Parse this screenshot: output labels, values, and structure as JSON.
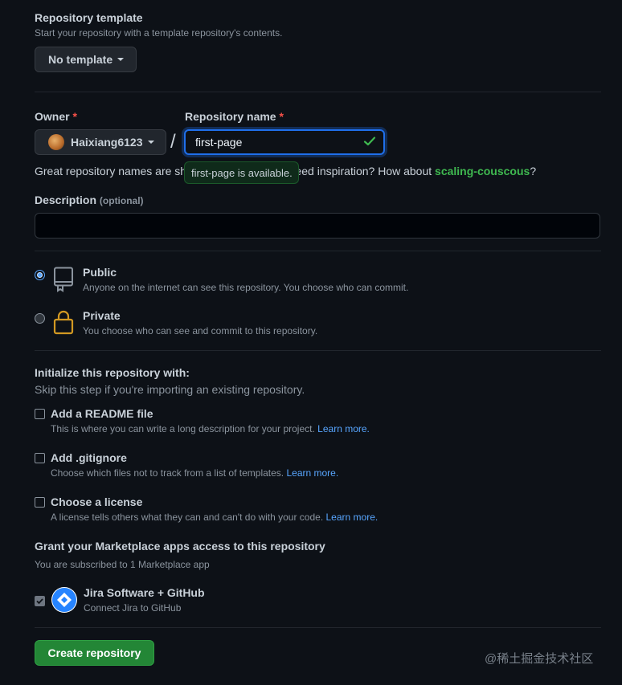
{
  "template": {
    "heading": "Repository template",
    "subtext": "Start your repository with a template repository's contents.",
    "button_label": "No template"
  },
  "owner": {
    "label": "Owner",
    "required_mark": "*",
    "username": "Haixiang6123"
  },
  "repo_name": {
    "label": "Repository name",
    "required_mark": "*",
    "value": "first-page",
    "separator": "/",
    "tooltip": "first-page is available."
  },
  "hint": {
    "prefix": "Great repository names are short and memorable. Need inspiration? How about",
    "suggestion": "scaling-couscous",
    "suffix": "?"
  },
  "description": {
    "label": "Description",
    "optional": "(optional)",
    "value": ""
  },
  "visibility": {
    "public": {
      "title": "Public",
      "desc": "Anyone on the internet can see this repository. You choose who can commit.",
      "selected": true
    },
    "private": {
      "title": "Private",
      "desc": "You choose who can see and commit to this repository.",
      "selected": false
    }
  },
  "initialize": {
    "heading": "Initialize this repository with:",
    "subtext": "Skip this step if you're importing an existing repository.",
    "options": [
      {
        "title": "Add a README file",
        "desc": "This is where you can write a long description for your project.",
        "link": "Learn more."
      },
      {
        "title": "Add .gitignore",
        "desc": "Choose which files not to track from a list of templates.",
        "link": "Learn more."
      },
      {
        "title": "Choose a license",
        "desc": "A license tells others what they can and can't do with your code.",
        "link": "Learn more."
      }
    ]
  },
  "marketplace": {
    "heading": "Grant your Marketplace apps access to this repository",
    "subtext": "You are subscribed to 1 Marketplace app",
    "app_name": "Jira Software + GitHub",
    "app_desc": "Connect Jira to GitHub"
  },
  "submit": {
    "label": "Create repository"
  },
  "watermark": "@稀土掘金技术社区",
  "colors": {
    "background": "#0d1117",
    "primary_button": "#238636",
    "accent_blue": "#58a6ff",
    "success_green": "#3fb950",
    "required_red": "#f85149"
  }
}
